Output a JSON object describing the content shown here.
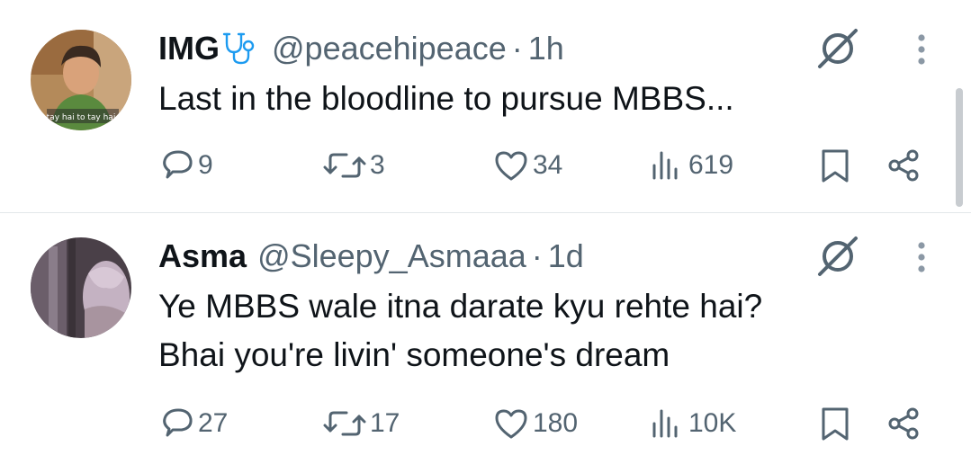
{
  "tweets": [
    {
      "name": "IMG",
      "handle": "@peacehipeace",
      "separator": "·",
      "time": "1h",
      "lines": [
        "Last in the bloodline to pursue MBBS..."
      ],
      "avatar_caption": "tay hai to tay hai",
      "replies": "9",
      "reposts": "3",
      "likes": "34",
      "views": "619"
    },
    {
      "name": "Asma",
      "handle": "@Sleepy_Asmaaa",
      "separator": "·",
      "time": "1d",
      "lines": [
        "Ye MBBS wale itna darate kyu rehte hai?",
        "Bhai you're livin' someone's dream"
      ],
      "replies": "27",
      "reposts": "17",
      "likes": "180",
      "views": "10K"
    }
  ],
  "icons": {
    "reply": "reply-icon",
    "repost": "repost-icon",
    "like": "heart-icon",
    "views": "views-icon",
    "bookmark": "bookmark-icon",
    "share": "share-icon",
    "grok": "grok-icon",
    "more": "more-icon",
    "badge": "stethoscope-icon"
  },
  "colors": {
    "text": "#0f1419",
    "secondary": "#536471",
    "badge": "#1d9bf0"
  }
}
